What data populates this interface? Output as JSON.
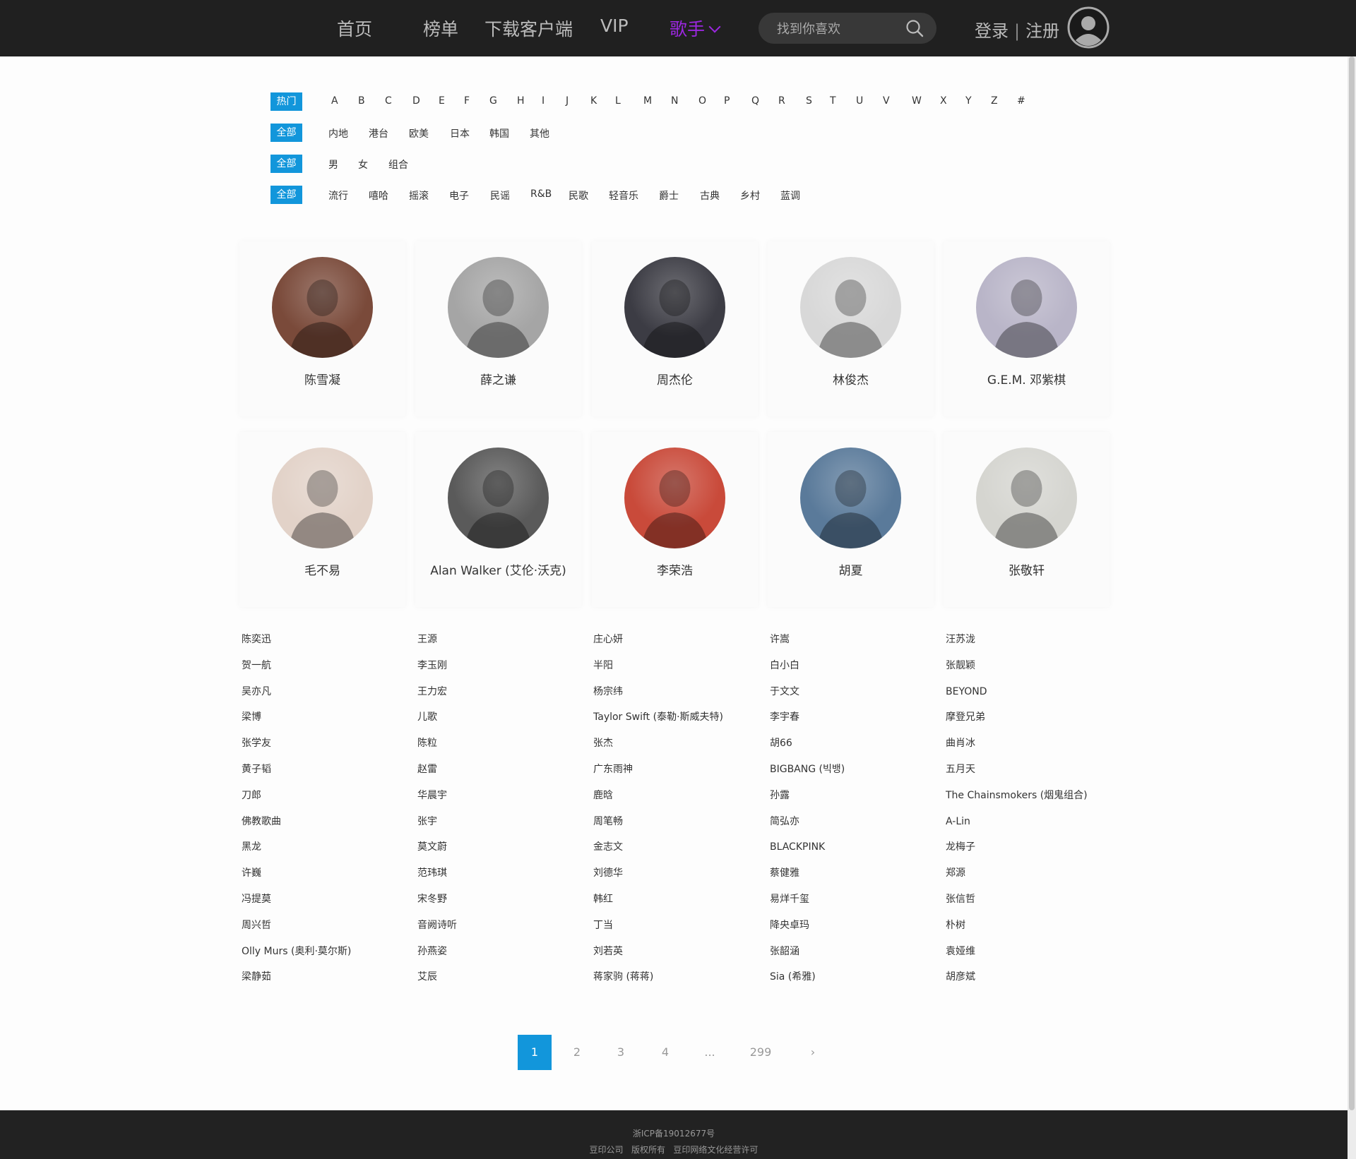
{
  "nav": {
    "home": "首页",
    "charts": "榜单",
    "download": "下载客户端",
    "vip": "VIP",
    "singers": "歌手"
  },
  "search": {
    "placeholder": "找到你喜欢"
  },
  "auth": {
    "login": "登录",
    "divider": "|",
    "register": "注册"
  },
  "filters": {
    "initial": {
      "badge": "热门",
      "options": [
        "A",
        "B",
        "C",
        "D",
        "E",
        "F",
        "G",
        "H",
        "I",
        "J",
        "K",
        "L",
        "M",
        "N",
        "O",
        "P",
        "Q",
        "R",
        "S",
        "T",
        "U",
        "V",
        "W",
        "X",
        "Y",
        "Z",
        "#"
      ]
    },
    "region": {
      "badge": "全部",
      "options": [
        "内地",
        "港台",
        "欧美",
        "日本",
        "韩国",
        "其他"
      ]
    },
    "gender": {
      "badge": "全部",
      "options": [
        "男",
        "女",
        "组合"
      ]
    },
    "genre": {
      "badge": "全部",
      "options": [
        "流行",
        "嘻哈",
        "摇滚",
        "电子",
        "民谣",
        "R&B",
        "民歌",
        "轻音乐",
        "爵士",
        "古典",
        "乡村",
        "蓝调"
      ]
    }
  },
  "featured": [
    {
      "name": "陈雪凝",
      "photo_bg": "#7a4a3a"
    },
    {
      "name": "薛之谦",
      "photo_bg": "#a5a5a5"
    },
    {
      "name": "周杰伦",
      "photo_bg": "#3c3c44"
    },
    {
      "name": "林俊杰",
      "photo_bg": "#d8d8d8"
    },
    {
      "name": "G.E.M. 邓紫棋",
      "photo_bg": "#b9b5c8"
    },
    {
      "name": "毛不易",
      "photo_bg": "#e2d2c8"
    },
    {
      "name": "Alan Walker (艾伦·沃克)",
      "photo_bg": "#5a5a5a"
    },
    {
      "name": "李荣浩",
      "photo_bg": "#c94a3a"
    },
    {
      "name": "胡夏",
      "photo_bg": "#5a7a9a"
    },
    {
      "name": "张敬轩",
      "photo_bg": "#d5d5d0"
    }
  ],
  "singer_columns": [
    [
      "陈奕迅",
      "贺一航",
      "吴亦凡",
      "梁博",
      "张学友",
      "黄子韬",
      "刀郎",
      "佛教歌曲",
      "黑龙",
      "许巍",
      "冯提莫",
      "周兴哲",
      "Olly Murs (奥利·莫尔斯)",
      "梁静茹"
    ],
    [
      "王源",
      "李玉刚",
      "王力宏",
      "儿歌",
      "陈粒",
      "赵雷",
      "华晨宇",
      "张宇",
      "莫文蔚",
      "范玮琪",
      "宋冬野",
      "音阙诗听",
      "孙燕姿",
      "艾辰"
    ],
    [
      "庄心妍",
      "半阳",
      "杨宗纬",
      "Taylor Swift (泰勒·斯威夫特)",
      "张杰",
      "广东雨神",
      "鹿晗",
      "周笔畅",
      "金志文",
      "刘德华",
      "韩红",
      "丁当",
      "刘若英",
      "蒋家驹 (蒋蒋)"
    ],
    [
      "许嵩",
      "白小白",
      "于文文",
      "李宇春",
      "胡66",
      "BIGBANG (빅뱅)",
      "孙露",
      "简弘亦",
      "BLACKPINK",
      "蔡健雅",
      "易烊千玺",
      "降央卓玛",
      "张韶涵",
      "Sia (希雅)"
    ],
    [
      "汪苏泷",
      "张靓颖",
      "BEYOND",
      "摩登兄弟",
      "曲肖冰",
      "五月天",
      "The Chainsmokers (烟鬼组合)",
      "A-Lin",
      "龙梅子",
      "郑源",
      "张信哲",
      "朴树",
      "袁娅维",
      "胡彦斌"
    ]
  ],
  "pagination": {
    "current": "1",
    "pages": [
      "2",
      "3",
      "4"
    ],
    "ellipsis": "...",
    "last": "299",
    "next": "›"
  },
  "footer": {
    "icp": "浙ICP备19012677号",
    "copyright": "豆印公司   版权所有   豆印网络文化经营许可"
  },
  "colors": {
    "header_bg": "#202020",
    "accent_purple": "#9b27e0",
    "accent_blue": "#1296db",
    "footer_bg": "#222222"
  }
}
